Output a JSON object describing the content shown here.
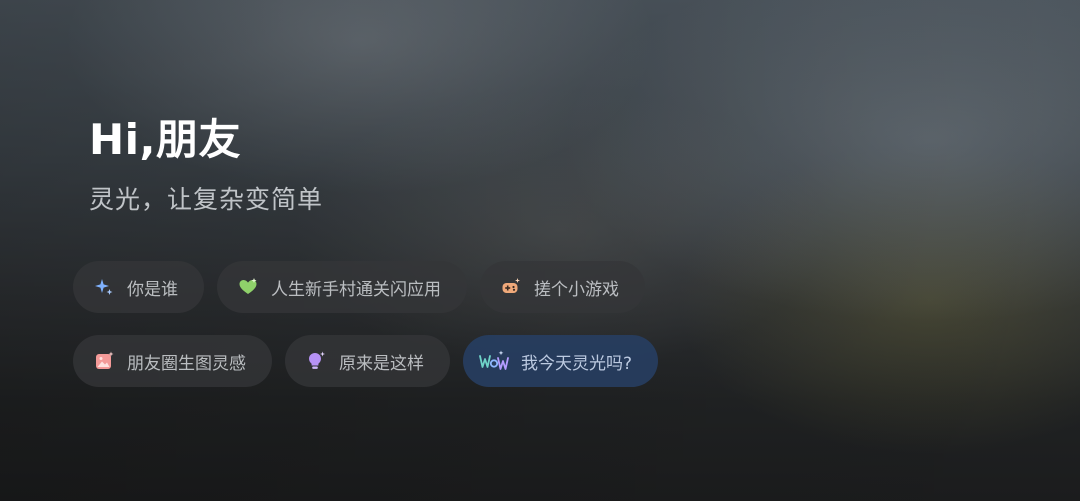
{
  "greeting": "Hi,朋友",
  "subtitle": "灵光，让复杂变简单",
  "suggestions_row1": [
    {
      "label": "你是谁",
      "icon": "sparkle-icon",
      "color": "#7fb2ff"
    },
    {
      "label": "人生新手村通关闪应用",
      "icon": "heart-sparkle-icon",
      "color": "#8fd16a"
    },
    {
      "label": "搓个小游戏",
      "icon": "gamepad-icon",
      "color": "#f0a97a"
    }
  ],
  "suggestions_row2": [
    {
      "label": "朋友圈生图灵感",
      "icon": "image-icon",
      "color": "#f49a98"
    },
    {
      "label": "原来是这样",
      "icon": "lightbulb-icon",
      "color": "#b692f5"
    },
    {
      "label": "我今天灵光吗?",
      "icon": "wow-icon",
      "color": "#7fc4ff"
    }
  ]
}
